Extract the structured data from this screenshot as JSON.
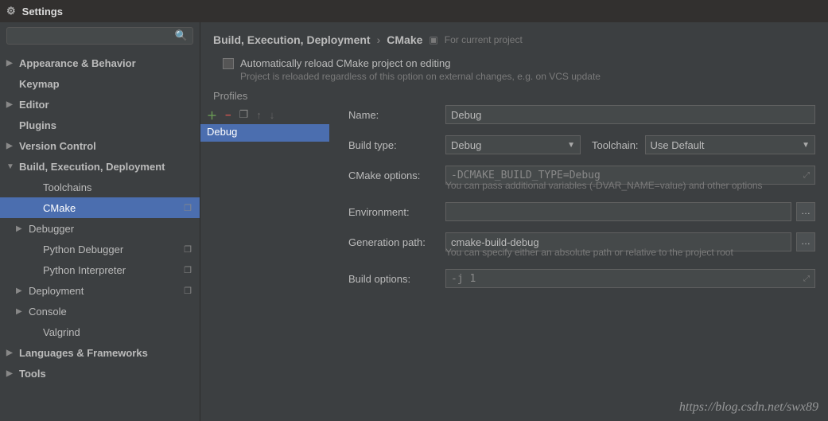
{
  "window_title": "Settings",
  "search_placeholder": "",
  "sidebar": [
    {
      "label": "Appearance & Behavior",
      "bold": true,
      "arrow": "right",
      "lvl": 0
    },
    {
      "label": "Keymap",
      "bold": true,
      "arrow": "none",
      "lvl": 0
    },
    {
      "label": "Editor",
      "bold": true,
      "arrow": "right",
      "lvl": 0
    },
    {
      "label": "Plugins",
      "bold": true,
      "arrow": "none",
      "lvl": 0
    },
    {
      "label": "Version Control",
      "bold": true,
      "arrow": "right",
      "lvl": 0
    },
    {
      "label": "Build, Execution, Deployment",
      "bold": true,
      "arrow": "down",
      "lvl": 0
    },
    {
      "label": "Toolchains",
      "bold": false,
      "arrow": "none",
      "lvl": 2
    },
    {
      "label": "CMake",
      "bold": false,
      "arrow": "none",
      "lvl": 2,
      "selected": true,
      "copy": true
    },
    {
      "label": "Debugger",
      "bold": false,
      "arrow": "right",
      "lvl": 1
    },
    {
      "label": "Python Debugger",
      "bold": false,
      "arrow": "none",
      "lvl": 2,
      "copy": true
    },
    {
      "label": "Python Interpreter",
      "bold": false,
      "arrow": "none",
      "lvl": 2,
      "copy": true
    },
    {
      "label": "Deployment",
      "bold": false,
      "arrow": "right",
      "lvl": 1,
      "copy": true
    },
    {
      "label": "Console",
      "bold": false,
      "arrow": "right",
      "lvl": 1
    },
    {
      "label": "Valgrind",
      "bold": false,
      "arrow": "none",
      "lvl": 2
    },
    {
      "label": "Languages & Frameworks",
      "bold": true,
      "arrow": "right",
      "lvl": 0
    },
    {
      "label": "Tools",
      "bold": true,
      "arrow": "right",
      "lvl": 0
    }
  ],
  "breadcrumb": {
    "seg1": "Build, Execution, Deployment",
    "seg2": "CMake",
    "hint": "For current project"
  },
  "auto_reload": {
    "label": "Automatically reload CMake project on editing",
    "hint": "Project is reloaded regardless of this option on external changes, e.g. on VCS update"
  },
  "profiles_label": "Profiles",
  "profiles": [
    {
      "name": "Debug",
      "selected": true
    }
  ],
  "form": {
    "name_label": "Name:",
    "name_value": "Debug",
    "buildtype_label": "Build type:",
    "buildtype_value": "Debug",
    "toolchain_label": "Toolchain:",
    "toolchain_value": "Use Default",
    "cmakeopts_label": "CMake options:",
    "cmakeopts_value": "-DCMAKE_BUILD_TYPE=Debug",
    "cmakeopts_hint": "You can pass additional variables (-DVAR_NAME=value) and other options",
    "env_label": "Environment:",
    "env_value": "",
    "genpath_label": "Generation path:",
    "genpath_value": "cmake-build-debug",
    "genpath_hint": "You can specify either an absolute path or relative to the project root",
    "buildopts_label": "Build options:",
    "buildopts_value": "-j 1"
  },
  "watermark": "https://blog.csdn.net/swx89"
}
